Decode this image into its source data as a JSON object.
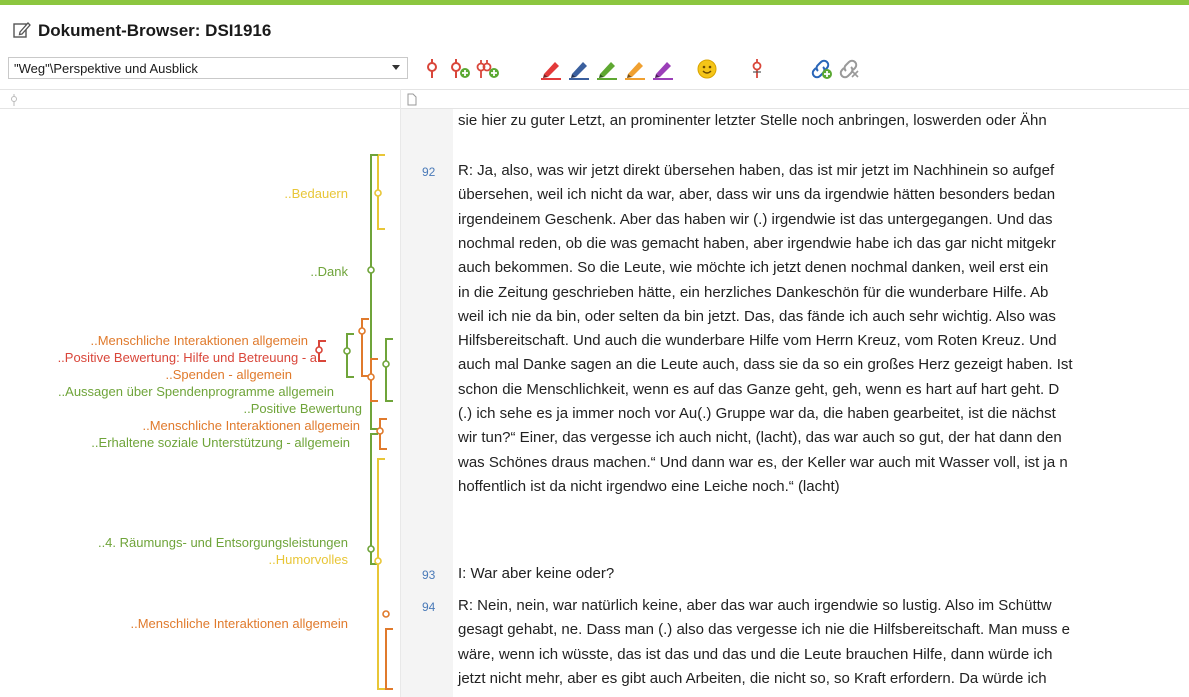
{
  "colors": {
    "accent_green": "#8cc63f",
    "code_yellow": "#e8c637",
    "code_green": "#6fa43a",
    "code_orange": "#e07a2c",
    "code_red": "#d9463a",
    "paragraph_number": "#4a7ab8"
  },
  "window": {
    "title": "Dokument-Browser: DSI1916",
    "title_icon": "edit-document-icon"
  },
  "toolbar": {
    "code_selector_value": "\"Weg\"\\Perspektive und Ausblick",
    "icons": [
      "code-icon",
      "add-code-icon",
      "add-code-multiple-icon",
      "highlighter-red-icon",
      "highlighter-blue-icon",
      "highlighter-green-icon",
      "highlighter-orange-icon",
      "highlighter-purple-icon",
      "emoticon-icon",
      "remove-code-icon",
      "link-add-icon",
      "link-remove-icon"
    ]
  },
  "codes": [
    {
      "label": "..Bedauern",
      "color": "yellow"
    },
    {
      "label": "..Dank",
      "color": "green"
    },
    {
      "label": "..Menschliche Interaktionen allgemein",
      "color": "orange"
    },
    {
      "label": "..Positive Bewertung: Hilfe und Betreuung - a",
      "color": "red"
    },
    {
      "label": "..Spenden - allgemein",
      "color": "orange"
    },
    {
      "label": "..Aussagen über Spendenprogramme allgemein",
      "color": "green"
    },
    {
      "label": "..Positive Bewertung",
      "color": "green"
    },
    {
      "label": "..Menschliche Interaktionen allgemein",
      "color": "orange"
    },
    {
      "label": "..Erhaltene soziale Unterstützung - allgemein",
      "color": "green"
    },
    {
      "label": "..4. Räumungs- und Entsorgungsleistungen",
      "color": "green"
    },
    {
      "label": "..Humorvolles",
      "color": "yellow"
    },
    {
      "label": "..Menschliche Interaktionen allgemein",
      "color": "orange"
    }
  ],
  "document": {
    "intro_line": "sie hier zu guter Letzt, an prominenter letzter Stelle noch anbringen, loswerden oder Ähn",
    "paragraphs": [
      {
        "number": "92",
        "lines": [
          "R: Ja, also, was wir jetzt direkt übersehen haben, das ist mir jetzt im Nachhinein so aufgef",
          "übersehen, weil ich nicht da war, aber, dass wir uns da irgendwie hätten besonders bedan",
          "irgendeinem Geschenk. Aber das haben wir (.) irgendwie ist das untergegangen. Und das",
          "nochmal reden, ob die was gemacht haben, aber irgendwie habe ich das gar nicht mitgekr",
          "auch bekommen. So die Leute, wie möchte ich jetzt  denen nochmal danken, weil erst ein",
          "in die Zeitung geschrieben hätte, ein herzliches Dankeschön für die wunderbare Hilfe. Ab",
          "weil ich nie da bin, oder selten da bin jetzt. Das, das fände ich auch sehr wichtig. Also was",
          "Hilfsbereitschaft. Und auch die wunderbare Hilfe vom Herrn Kreuz, vom Roten Kreuz. Und",
          "auch mal Danke sagen an die Leute auch, dass sie da so ein großes Herz gezeigt haben. Ist",
          "schon die Menschlichkeit, wenn es auf das Ganze geht, geh, wenn es hart auf hart geht. D",
          "(.) ich sehe es ja immer noch vor Au(.) Gruppe war da, die haben gearbeitet, ist die nächst",
          "wir tun?“ Einer, das vergesse ich auch nicht, (lacht), das war auch so gut, der hat dann den",
          "was Schönes draus machen.“ Und dann war es, der Keller war auch mit Wasser voll, ist ja n",
          "hoffentlich ist da nicht irgendwo eine Leiche noch.“ (lacht)"
        ]
      },
      {
        "number": "93",
        "lines": [
          "I: War aber keine oder?"
        ]
      },
      {
        "number": "94",
        "lines": [
          "R: Nein, nein, war natürlich keine, aber das war auch irgendwie so lustig. Also im Schüttw",
          "gesagt gehabt, ne. Dass man (.) also das vergesse ich nie die Hilfsbereitschaft. Man muss e",
          "wäre, wenn ich wüsste, das ist das und das und die Leute brauchen Hilfe, dann würde ich",
          "jetzt nicht mehr, aber es gibt auch Arbeiten, die nicht so, so Kraft erfordern. Da würde ich"
        ]
      }
    ]
  }
}
